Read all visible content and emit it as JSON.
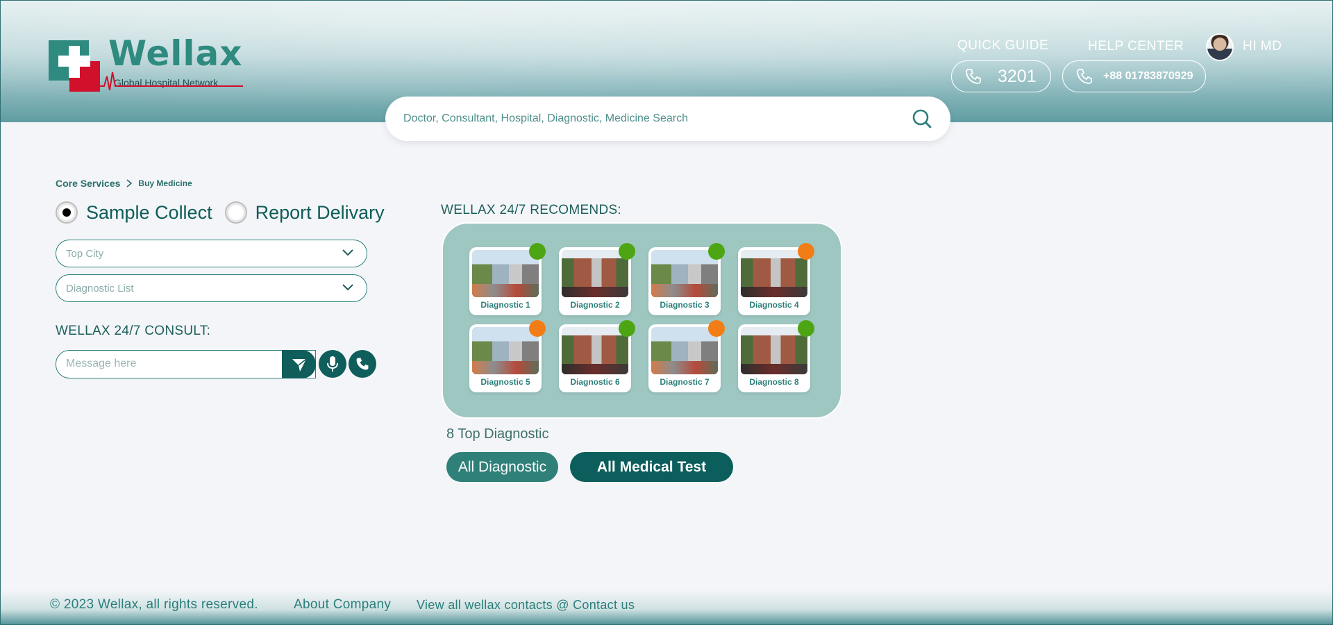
{
  "header": {
    "brand": {
      "name": "Wellax",
      "tagline": "Global Hospital Network"
    },
    "quick_guide": {
      "label": "QUICK GUIDE",
      "number": "3201"
    },
    "help_center": {
      "label": "HELP CENTER",
      "number": "+88 01783870929"
    },
    "user": {
      "greeting": "HI MD"
    },
    "search": {
      "placeholder": "Doctor, Consultant, Hospital, Diagnostic, Medicine Search"
    }
  },
  "breadcrumb": {
    "parent": "Core Services",
    "current": "Buy Medicine"
  },
  "service_options": {
    "selected": "Sample Collect",
    "options": [
      "Sample Collect",
      "Report Delivary"
    ]
  },
  "filters": {
    "city": {
      "placeholder": "Top City"
    },
    "diagnostic": {
      "placeholder": "Diagnostic List"
    }
  },
  "consult": {
    "title": "WELLAX 24/7 CONSULT:",
    "message_placeholder": "Message here"
  },
  "recommendations": {
    "title": "WELLAX 24/7 RECOMENDS:",
    "items": [
      {
        "name": "Diagnostic 1",
        "status": "green"
      },
      {
        "name": "Diagnostic 2",
        "status": "green"
      },
      {
        "name": "Diagnostic 3",
        "status": "green"
      },
      {
        "name": "Diagnostic 4",
        "status": "orange"
      },
      {
        "name": "Diagnostic 5",
        "status": "orange"
      },
      {
        "name": "Diagnostic 6",
        "status": "green"
      },
      {
        "name": "Diagnostic 7",
        "status": "orange"
      },
      {
        "name": "Diagnostic 8",
        "status": "green"
      }
    ],
    "count_label": "8 Top Diagnostic",
    "buttons": {
      "all_diagnostic": "All Diagnostic",
      "all_medical_test": "All Medical Test"
    }
  },
  "footer": {
    "copyright": "© 2023 Wellax, all rights reserved.",
    "about": "About Company",
    "contacts": "View all wellax contacts @ Contact us"
  },
  "colors": {
    "primary": "#0f5e5c",
    "accent": "#2f8a7f",
    "brand_red": "#d1102b",
    "status_green": "#4ea514",
    "status_orange": "#f27d17"
  }
}
